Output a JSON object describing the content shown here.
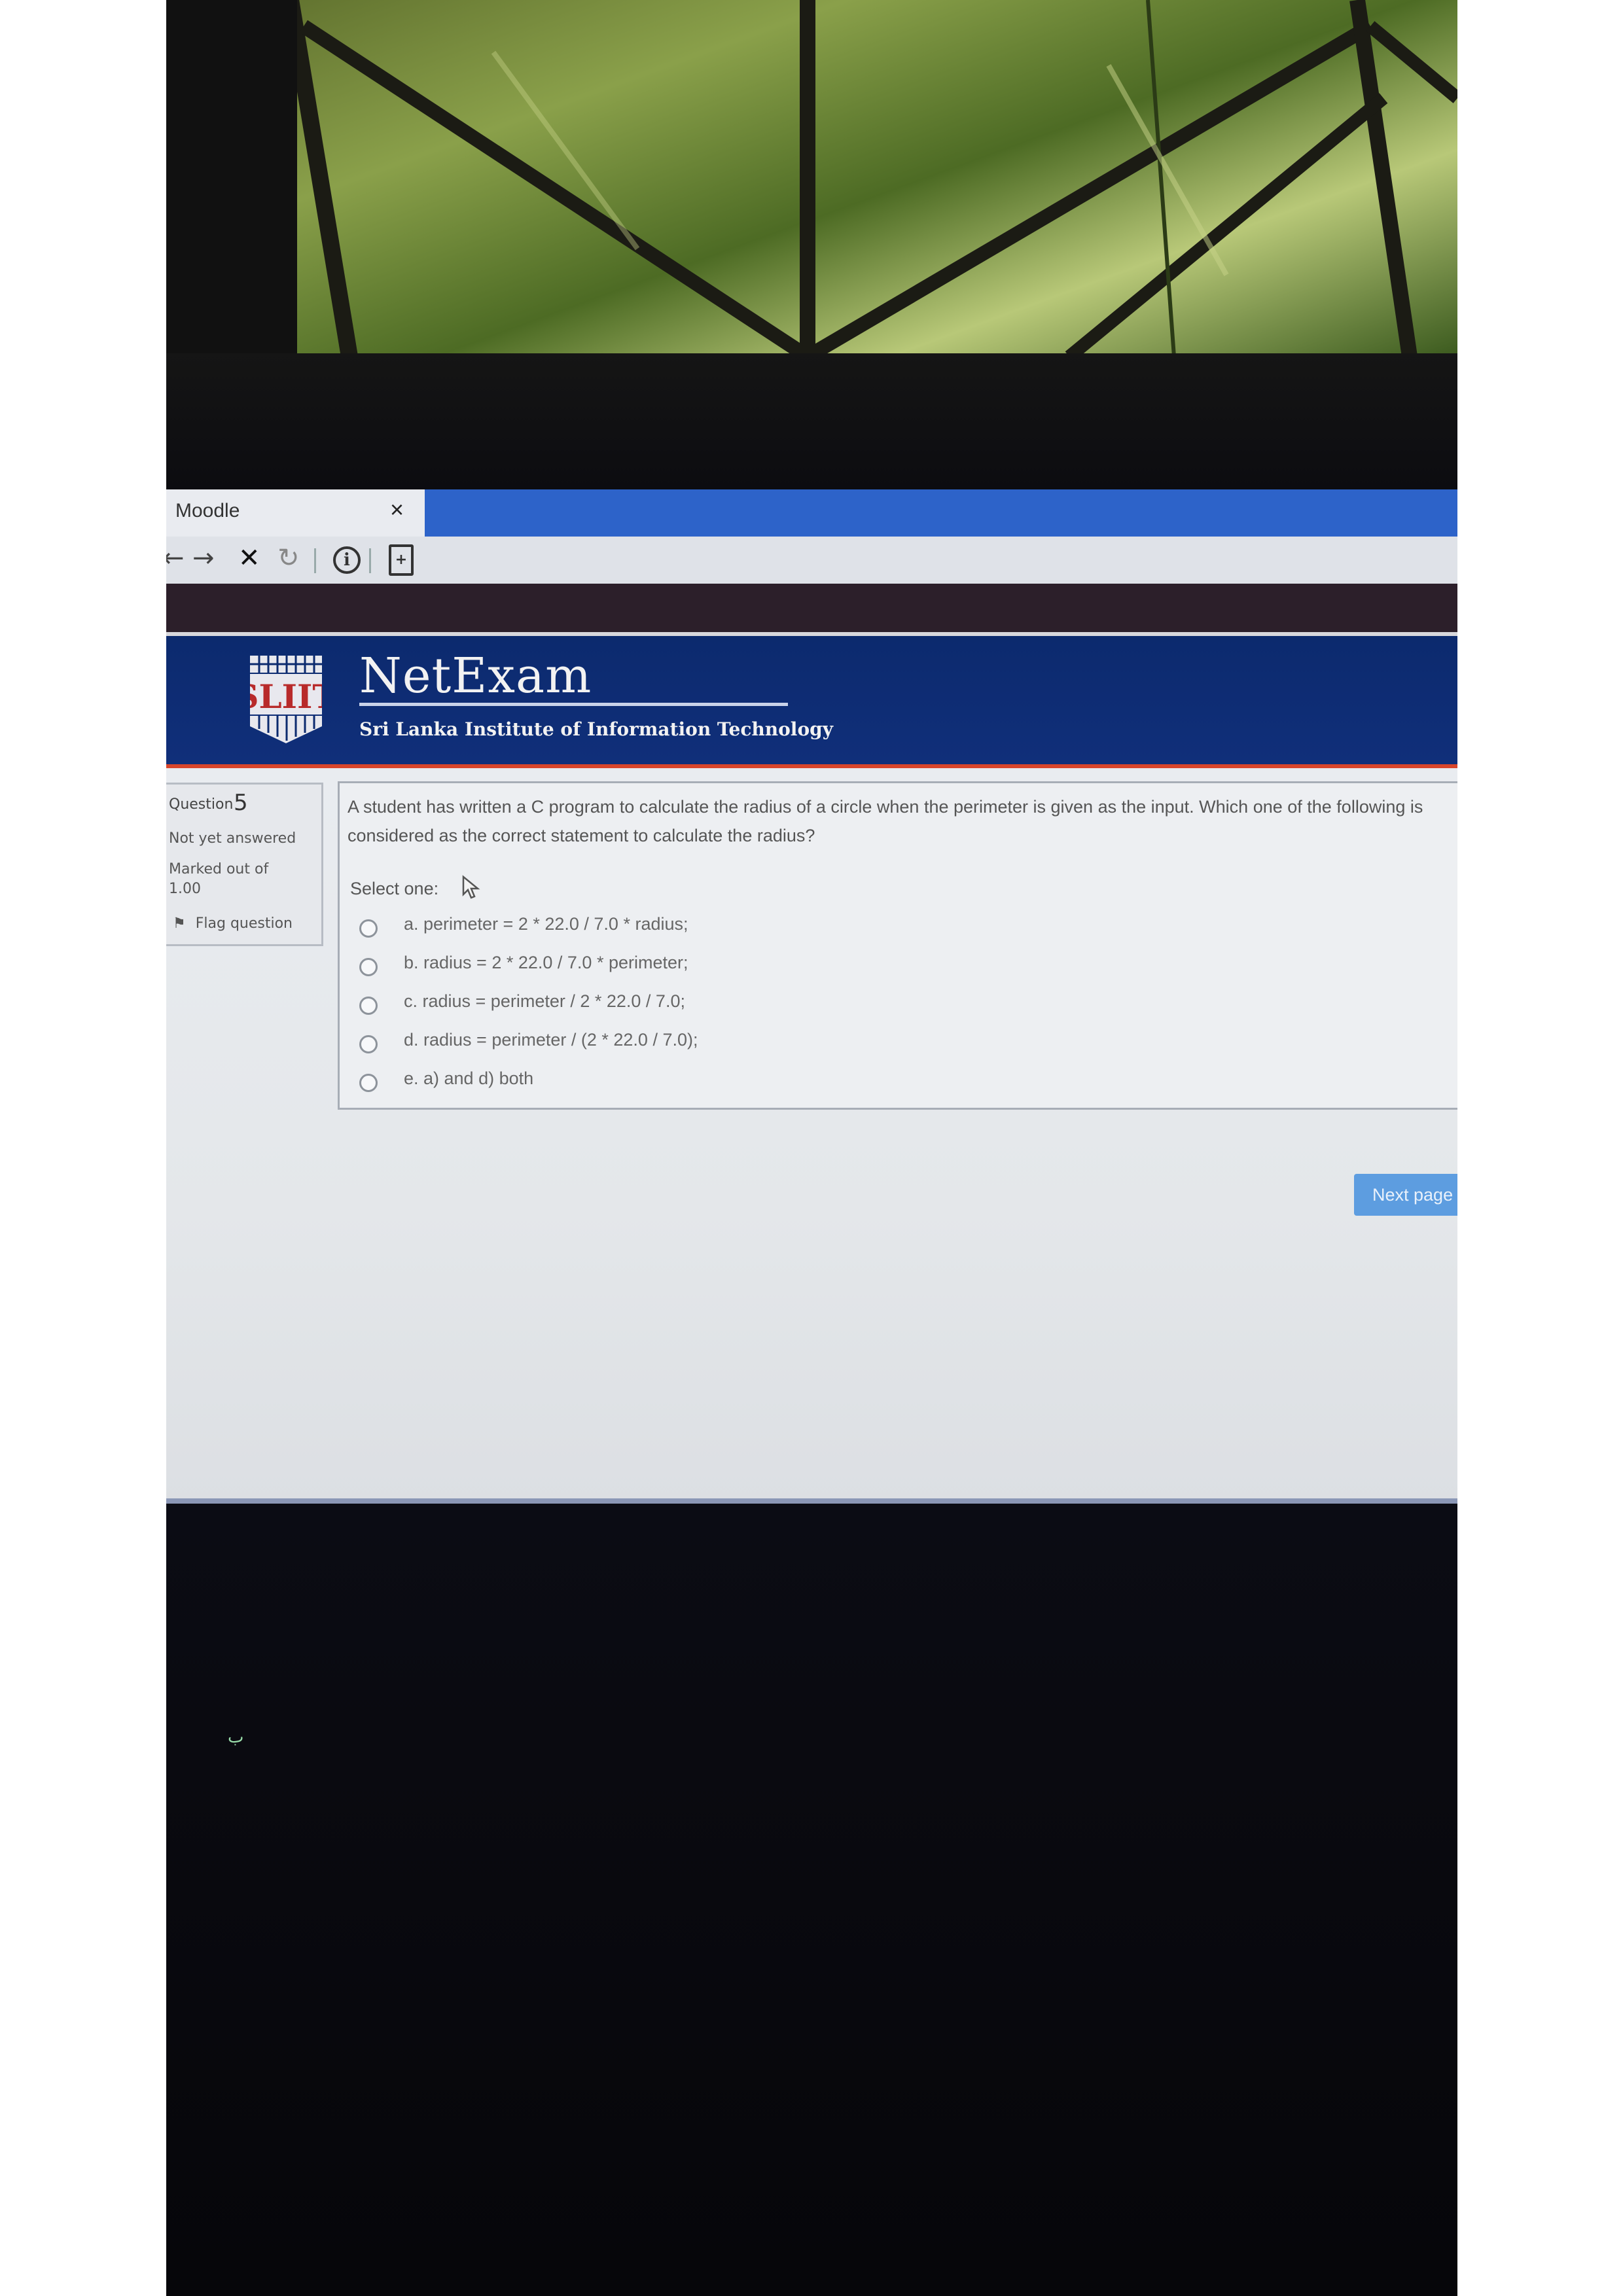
{
  "browser": {
    "tab_title": "Moodle",
    "tab_close": "×",
    "nav": {
      "back": "←",
      "forward": "→",
      "stop": "✕",
      "reload": "↻",
      "info": "i",
      "doc": "+"
    }
  },
  "header": {
    "brand": "NetExam",
    "subtitle": "Sri Lanka Institute of Information Technology",
    "logo_text": "SLIIT"
  },
  "question_info": {
    "label": "Question",
    "number": "5",
    "state": "Not yet answered",
    "marked": "Marked out of 1.00",
    "flag": "Flag question"
  },
  "question": {
    "text": "A student has written a C program to calculate the radius of a circle when the perimeter is given as the input. Which one of the following is considered as the correct statement to calculate the radius?",
    "select_label": "Select one:",
    "options": [
      "a. perimeter = 2 * 22.0 / 7.0 * radius;",
      "b. radius = 2 * 22.0 / 7.0 * perimeter;",
      "c. radius = perimeter / 2 * 22.0 / 7.0;",
      "d. radius = perimeter / (2 * 22.0 / 7.0);",
      "e. a) and d) both"
    ]
  },
  "footer": {
    "next_label": "Next page"
  }
}
